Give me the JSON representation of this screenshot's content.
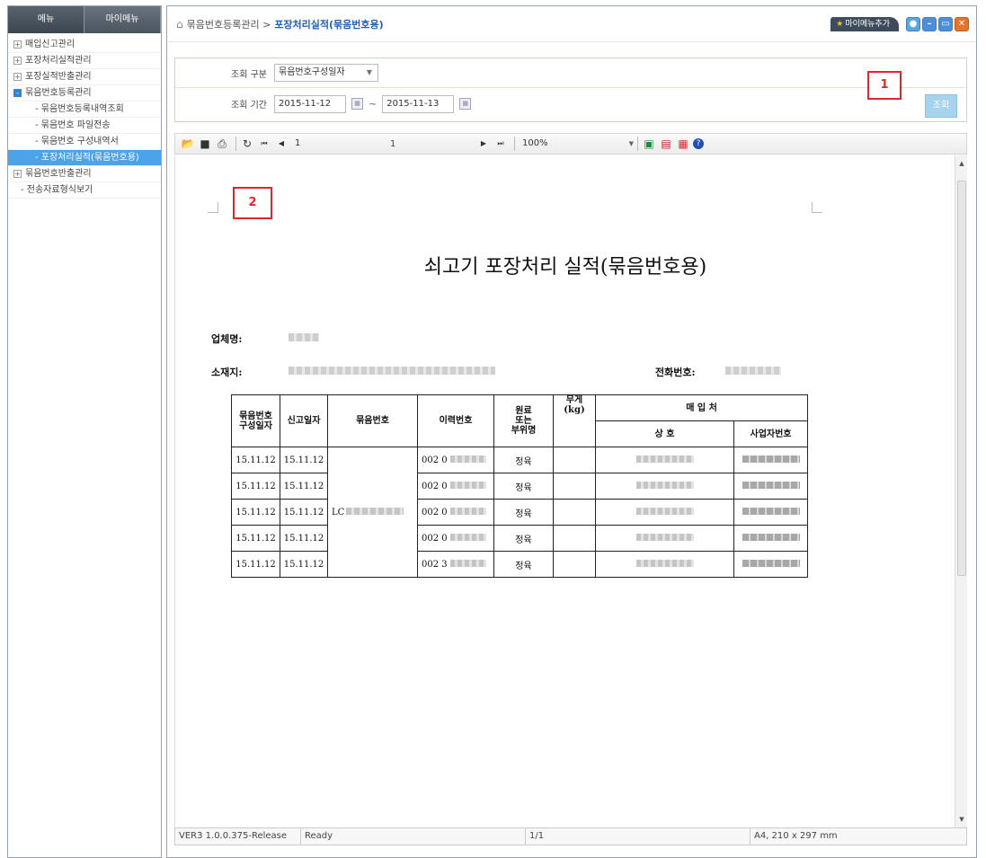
{
  "left": {
    "tabs": [
      "메뉴",
      "마이메뉴"
    ],
    "items": [
      {
        "label": "매입신고관리",
        "type": "plus"
      },
      {
        "label": "포장처리실적관리",
        "type": "plus"
      },
      {
        "label": "포장실적반출관리",
        "type": "plus"
      },
      {
        "label": "묶음번호등록관리",
        "type": "minus"
      },
      {
        "label": "- 묶음번호등록내역조회",
        "type": "sub"
      },
      {
        "label": "- 묶음번호 파일전송",
        "type": "sub"
      },
      {
        "label": "- 묶음번호 구성내역서",
        "type": "sub"
      },
      {
        "label": "- 포장처리실적(묶음번호용)",
        "type": "sub-selected"
      },
      {
        "label": "묶음번호반출관리",
        "type": "plus"
      },
      {
        "label": "- 전송자료형식보기",
        "type": "flat"
      }
    ]
  },
  "header": {
    "crumb": "묶음번호등록관리 >",
    "current": "포장처리실적(묶음번호용)",
    "mymenu_add": "마이메뉴추가"
  },
  "search": {
    "type_label": "조회 구분",
    "type_value": "묶음번호구성일자",
    "period_label": "조회 기간",
    "date_from": "2015-11-12",
    "date_to": "2015-11-13",
    "tilde": "~",
    "button": "조회"
  },
  "markers": {
    "m1": "1",
    "m2": "2"
  },
  "toolbar": {
    "page_current": "1",
    "page_total": "1",
    "zoom": "100%"
  },
  "report": {
    "title": "쇠고기 포장처리 실적(묶음번호용)",
    "company_label": "업체명:",
    "address_label": "소재지:",
    "phone_label": "전화번호:",
    "headers": {
      "date": "묶음번호\n구성일자",
      "report_date": "신고일자",
      "bundle": "묶음번호",
      "trace": "이력번호",
      "part": "원료\n또는\n부위명",
      "weight": "무게\n(kg)",
      "buyer": "매 입 처",
      "name": "상 호",
      "bizno": "사업자번호"
    },
    "bundle_prefix": "LC",
    "rows": [
      {
        "date": "15.11.12",
        "report_date": "15.11.12",
        "trace": "002 0",
        "part": "정육"
      },
      {
        "date": "15.11.12",
        "report_date": "15.11.12",
        "trace": "002 0",
        "part": "정육"
      },
      {
        "date": "15.11.12",
        "report_date": "15.11.12",
        "trace": "002 0",
        "part": "정육"
      },
      {
        "date": "15.11.12",
        "report_date": "15.11.12",
        "trace": "002 0",
        "part": "정육"
      },
      {
        "date": "15.11.12",
        "report_date": "15.11.12",
        "trace": "002 3",
        "part": "정육"
      }
    ]
  },
  "status": {
    "version": "VER3 1.0.0.375-Release",
    "state": "Ready",
    "page": "1/1",
    "paper": "A4, 210 x 297 mm"
  }
}
